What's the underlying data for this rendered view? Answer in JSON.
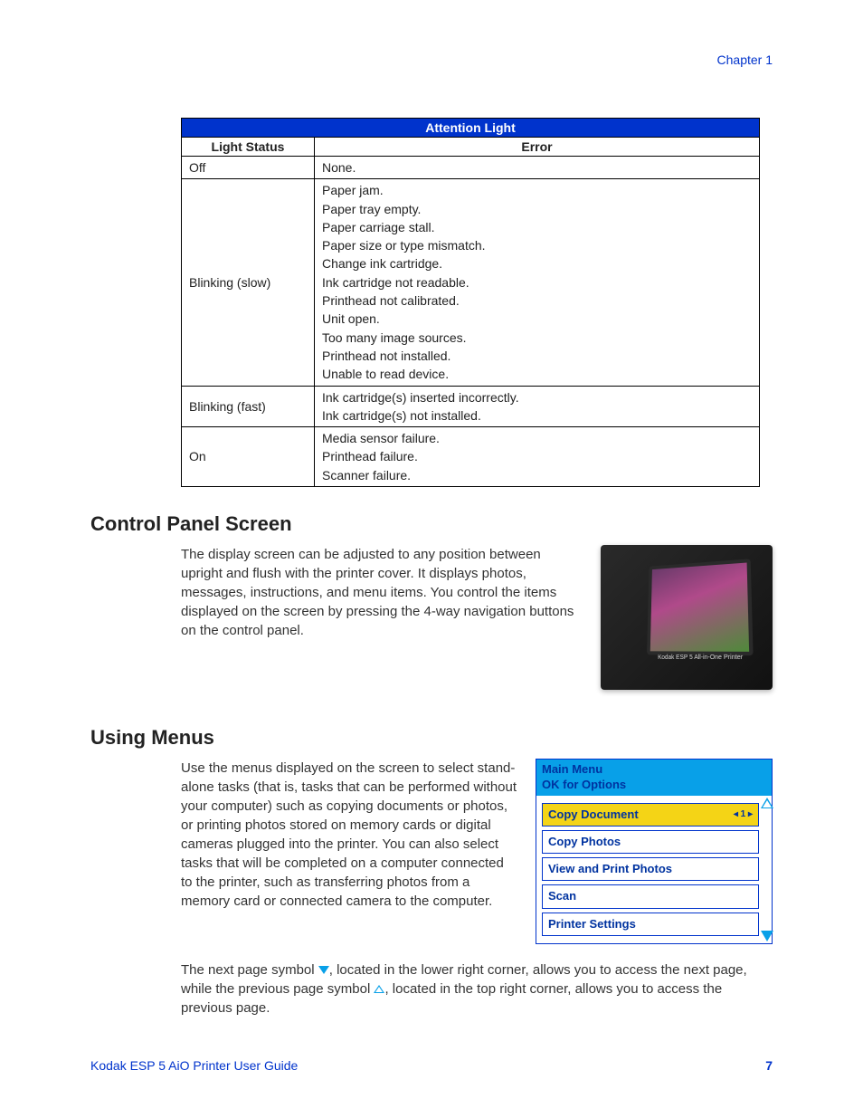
{
  "header": {
    "chapter": "Chapter 1"
  },
  "table": {
    "title": "Attention Light",
    "col1": "Light Status",
    "col2": "Error",
    "rows": [
      {
        "status": "Off",
        "errors": [
          "None."
        ]
      },
      {
        "status": "Blinking (slow)",
        "errors": [
          "Paper jam.",
          "Paper tray empty.",
          "Paper carriage stall.",
          "Paper size or type mismatch.",
          "Change ink cartridge.",
          "Ink cartridge not readable.",
          "Printhead not calibrated.",
          "Unit open.",
          "Too many image sources.",
          "Printhead not installed.",
          "Unable to read device."
        ]
      },
      {
        "status": "Blinking (fast)",
        "errors": [
          "Ink cartridge(s) inserted incorrectly.",
          "Ink cartridge(s) not installed."
        ]
      },
      {
        "status": "On",
        "errors": [
          "Media sensor failure.",
          "Printhead failure.",
          "Scanner failure."
        ]
      }
    ]
  },
  "sections": {
    "control_panel": {
      "heading": "Control Panel Screen",
      "body": "The display screen can be adjusted to any position between upright and flush with the printer cover. It displays photos, messages, instructions, and menu items. You control the items displayed on the screen by pressing the 4-way navigation buttons on the control panel.",
      "photo_label": "Kodak ESP 5 All-in-One Printer"
    },
    "using_menus": {
      "heading": "Using Menus",
      "body1": "Use the menus displayed on the screen to select stand-alone tasks (that is, tasks that can   be performed without your computer) such as copying documents or photos, or printing photos stored on memory cards or digital cameras plugged into the printer. You can also select tasks that will be completed on a computer connected to the printer, such as transferring photos from a memory card or connected camera to the computer.",
      "body2_a": "The next page symbol ",
      "body2_b": ", located in the lower right corner, allows you to access the next page, while the previous page symbol ",
      "body2_c": ", located in the top right corner, allows you to access the previous page."
    }
  },
  "menu": {
    "title_line1": "Main Menu",
    "title_line2": "OK for Options",
    "items": [
      {
        "label": "Copy Document",
        "selected": true,
        "indicator": "◂ 1 ▸"
      },
      {
        "label": "Copy Photos",
        "selected": false
      },
      {
        "label": "View and Print Photos",
        "selected": false
      },
      {
        "label": "Scan",
        "selected": false
      },
      {
        "label": "Printer Settings",
        "selected": false
      }
    ]
  },
  "footer": {
    "guide": "Kodak ESP 5 AiO Printer User Guide",
    "page": "7"
  }
}
